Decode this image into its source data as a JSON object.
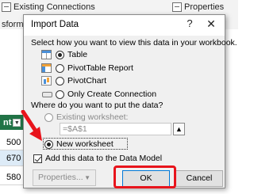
{
  "background": {
    "ribbon": {
      "existing_connections": "Existing Connections",
      "properties": "Properties",
      "side_text": "sform D"
    },
    "column_header": "nt",
    "cells": [
      "500",
      "670",
      "580"
    ]
  },
  "dialog": {
    "title": "Import Data",
    "help": "?",
    "close": "✕",
    "view_prompt": "Select how you want to view this data in your workbook.",
    "view_options": [
      {
        "icon": "table-icon",
        "label": "Table",
        "selected": true
      },
      {
        "icon": "pivottable-icon",
        "label": "PivotTable Report",
        "selected": false
      },
      {
        "icon": "pivotchart-icon",
        "label": "PivotChart",
        "selected": false
      },
      {
        "icon": "connection-icon",
        "label": "Only Create Connection",
        "selected": false
      }
    ],
    "location_prompt": "Where do you want to put the data?",
    "existing_worksheet_label": "Existing worksheet:",
    "existing_worksheet_value": "=$A$1",
    "new_worksheet_label": "New worksheet",
    "add_to_model_label": "Add this data to the Data Model",
    "properties_button": "Properties...",
    "ok_button": "OK",
    "cancel_button": "Cancel"
  },
  "colors": {
    "annotation": "#e8141c",
    "excel_green": "#217346",
    "ok_focus": "#0078d7"
  }
}
